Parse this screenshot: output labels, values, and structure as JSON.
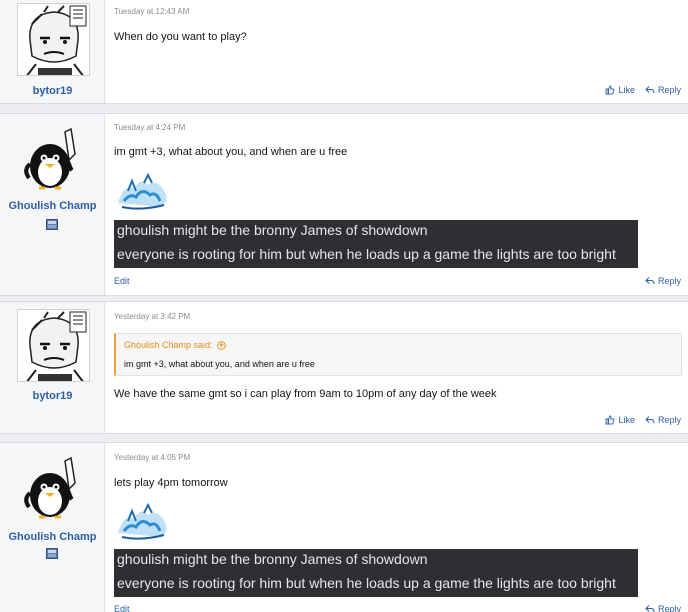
{
  "posts": [
    {
      "username": "bytor19",
      "time": "Tuesday at 12:43 AM",
      "message": "When do you want to play?",
      "like_label": "Like",
      "reply_label": "Reply"
    },
    {
      "username": "Ghoulish Champ",
      "time": "Tuesday at 4:24 PM",
      "message": "im gmt +3, what about you, and when are u free",
      "signature_line1": "ghoulish might be the bronny James of showdown",
      "signature_line2": "everyone is rooting for him but when he loads up a game the lights are too bright",
      "edit_label": "Edit",
      "reply_label": "Reply"
    },
    {
      "username": "bytor19",
      "time": "Yesterday at 3:42 PM",
      "quote_author": "Ghoulish Champ said:",
      "quote_text": "im gmt +3, what about you, and when are u free",
      "message": "We have the same gmt so i can play from 9am to 10pm of any day of the week",
      "like_label": "Like",
      "reply_label": "Reply"
    },
    {
      "username": "Ghoulish Champ",
      "time": "Yesterday at 4:05 PM",
      "message": "lets play 4pm tomorrow",
      "signature_line1": "ghoulish might be the bronny James of showdown",
      "signature_line2": "everyone is rooting for him but when he loads up a game the lights are too bright",
      "edit_label": "Edit",
      "reply_label": "Reply"
    }
  ],
  "icons": {
    "like": "thumbs-up-icon",
    "reply": "reply-arrow-icon",
    "quote_jump": "arrow-up-circle-icon",
    "flag": "flag-icon",
    "signature_logo": "asia-logo"
  },
  "colors": {
    "link": "#2d5fa8",
    "quote_accent": "#f0a040",
    "signature_bg": "#2d2f33"
  }
}
